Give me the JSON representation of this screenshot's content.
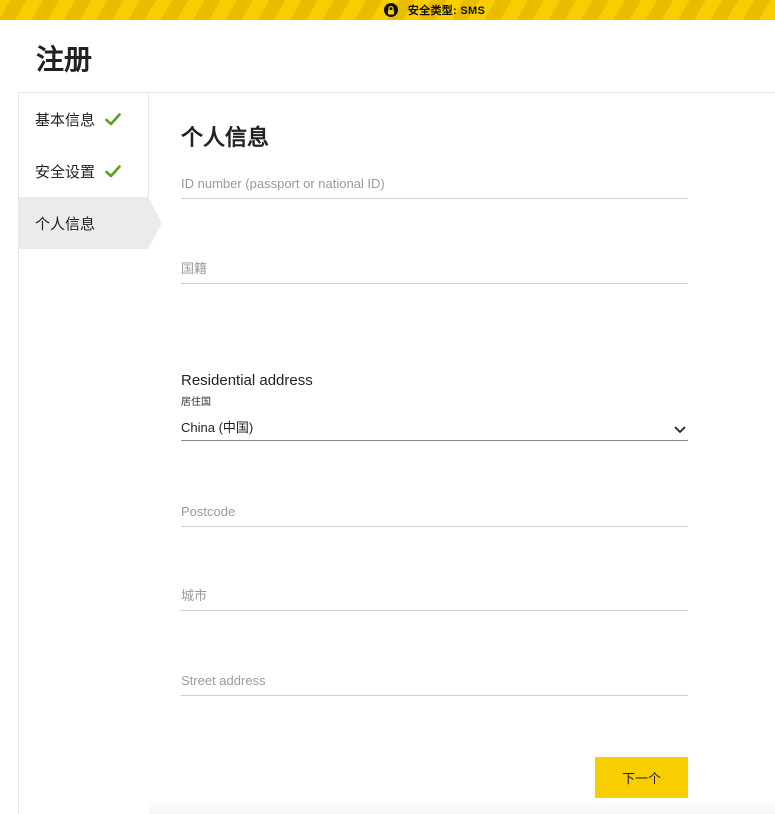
{
  "banner": {
    "text": "安全类型: SMS",
    "icon": "lock-icon"
  },
  "page": {
    "title": "注册"
  },
  "sidebar": {
    "items": [
      {
        "label": "基本信息",
        "completed": true,
        "icon": "check-icon"
      },
      {
        "label": "安全设置",
        "completed": true,
        "icon": "check-icon"
      },
      {
        "label": "个人信息",
        "completed": false,
        "active": true
      }
    ]
  },
  "form": {
    "title": "个人信息",
    "id_number": {
      "placeholder": "ID number (passport or national ID)",
      "value": ""
    },
    "nationality": {
      "placeholder": "国籍",
      "value": ""
    },
    "residential": {
      "heading": "Residential address",
      "country_label": "居住国",
      "country_value": "China (中国)"
    },
    "postcode": {
      "placeholder": "Postcode",
      "value": ""
    },
    "city": {
      "placeholder": "城市",
      "value": ""
    },
    "street": {
      "placeholder": "Street address",
      "value": ""
    },
    "next_label": "下一个"
  },
  "colors": {
    "accent": "#f7cf00",
    "check": "#5aa21c",
    "active_bg": "#ebebeb"
  }
}
